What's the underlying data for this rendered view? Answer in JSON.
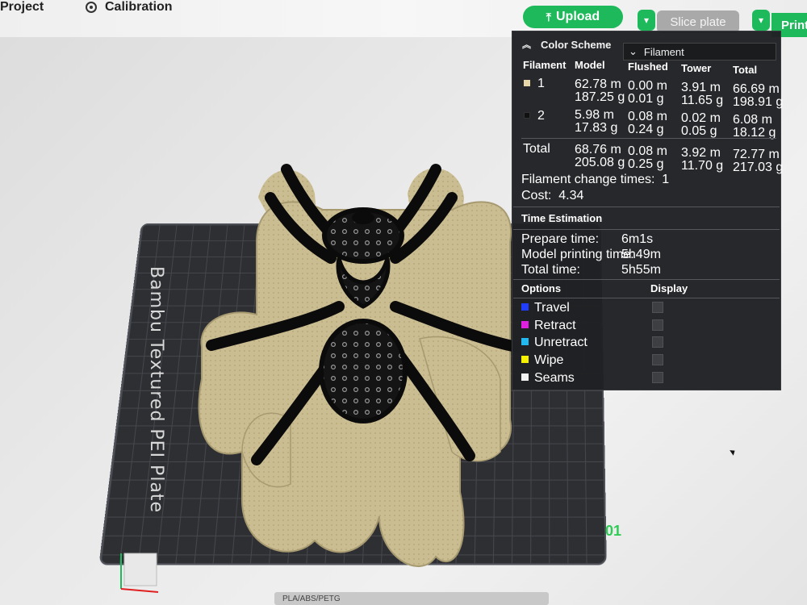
{
  "topbar": {
    "project_label": "Project",
    "calibration_label": "Calibration",
    "upload_label": "Upload",
    "slice_label": "Slice plate",
    "print_label": "Print"
  },
  "viewport": {
    "bed_label": "Bambu Textured PEI Plate",
    "plate_number": "01",
    "filament_strip": "PLA/ABS/PETG"
  },
  "panel": {
    "color_scheme_label": "Color Scheme",
    "color_scheme_value": "Filament",
    "columns": [
      "Filament",
      "Model",
      "Flushed",
      "Tower",
      "Total"
    ],
    "rows": [
      {
        "id": "1",
        "color": "#e6d6a8",
        "model": [
          "62.78 m",
          "187.25 g"
        ],
        "flushed": [
          "0.00 m",
          "0.01 g"
        ],
        "tower": [
          "3.91 m",
          "11.65 g"
        ],
        "total": [
          "66.69 m",
          "198.91 g"
        ]
      },
      {
        "id": "2",
        "color": "#111111",
        "model": [
          "5.98 m",
          "17.83 g"
        ],
        "flushed": [
          "0.08 m",
          "0.24 g"
        ],
        "tower": [
          "0.02 m",
          "0.05 g"
        ],
        "total": [
          "6.08 m",
          "18.12 g"
        ]
      }
    ],
    "total_row": {
      "label": "Total",
      "model": [
        "68.76 m",
        "205.08 g"
      ],
      "flushed": [
        "0.08 m",
        "0.25 g"
      ],
      "tower": [
        "3.92 m",
        "11.70 g"
      ],
      "total": [
        "72.77 m",
        "217.03 g"
      ]
    },
    "filament_change_label": "Filament change times:",
    "filament_change_value": "1",
    "cost_label": "Cost:",
    "cost_value": "4.34",
    "time_estimation_title": "Time Estimation",
    "prepare_label": "Prepare time:",
    "prepare_value": "6m1s",
    "model_printing_label": "Model printing time:",
    "model_printing_value": "5h49m",
    "total_time_label": "Total time:",
    "total_time_value": "5h55m",
    "options_title": "Options",
    "display_title": "Display",
    "options": [
      {
        "label": "Travel",
        "color": "#1f3cff"
      },
      {
        "label": "Retract",
        "color": "#e020e0"
      },
      {
        "label": "Unretract",
        "color": "#22b8f0"
      },
      {
        "label": "Wipe",
        "color": "#f5f000"
      },
      {
        "label": "Seams",
        "color": "#f2f2f2"
      }
    ]
  }
}
